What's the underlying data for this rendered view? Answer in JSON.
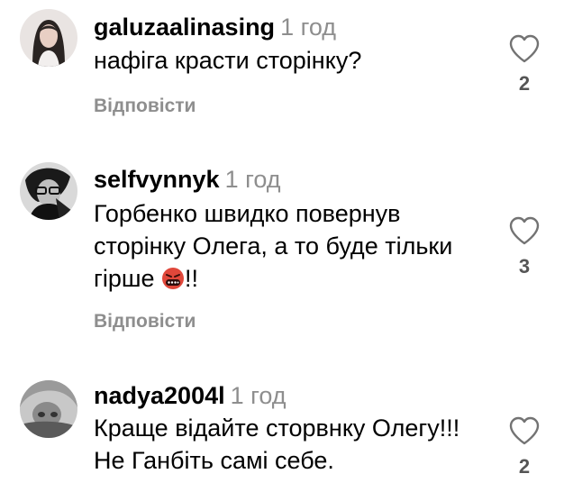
{
  "comments": [
    {
      "username": "galuzaalinasing",
      "time": "1 год",
      "text": "нафіга красти сторінку?",
      "reply_label": "Відповісти",
      "likes": "2",
      "avatar_icon": "woman-portrait-avatar",
      "like_icon": "heart-outline-icon"
    },
    {
      "username": "selfvynnyk",
      "time": "1 год",
      "text_line1": "Горбенко швидко повернув",
      "text_line2": "сторінку Олега, а то буде тільки",
      "text_line3_before": "гірше ",
      "text_line3_after": "!!",
      "emoji_icon": "face-with-symbols-on-mouth-emoji",
      "reply_label": "Відповісти",
      "likes": "3",
      "avatar_icon": "man-with-glasses-avatar",
      "like_icon": "heart-outline-icon"
    },
    {
      "username": "nadya2004l",
      "time": "1 год",
      "text_line1": "Краще відайте сторвнку Олегу!!!",
      "text_line2": "Не Ганбіть самі себе.",
      "likes": "2",
      "avatar_icon": "grayscale-portrait-avatar",
      "like_icon": "heart-outline-icon"
    }
  ],
  "colors": {
    "text": "#000000",
    "muted": "#8e8e8e",
    "like_count": "#555555",
    "background": "#ffffff"
  }
}
